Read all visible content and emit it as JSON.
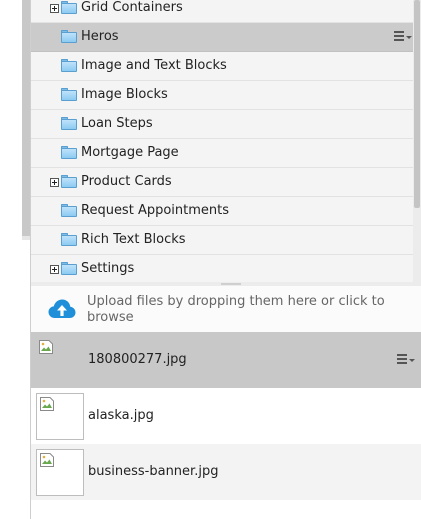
{
  "tree": {
    "items": [
      {
        "label": "Grid Containers",
        "expandable": true,
        "selected": false
      },
      {
        "label": "Heros",
        "expandable": false,
        "selected": true
      },
      {
        "label": "Image and Text Blocks",
        "expandable": false,
        "selected": false
      },
      {
        "label": "Image Blocks",
        "expandable": false,
        "selected": false
      },
      {
        "label": "Loan Steps",
        "expandable": false,
        "selected": false
      },
      {
        "label": "Mortgage Page",
        "expandable": false,
        "selected": false
      },
      {
        "label": "Product Cards",
        "expandable": true,
        "selected": false
      },
      {
        "label": "Request Appointments",
        "expandable": false,
        "selected": false
      },
      {
        "label": "Rich Text Blocks",
        "expandable": false,
        "selected": false
      },
      {
        "label": "Settings",
        "expandable": true,
        "selected": false
      }
    ]
  },
  "upload": {
    "text": "Upload files by dropping them here or click to browse",
    "icon": "cloud-upload-icon",
    "icon_color": "#1e8fd8"
  },
  "files": [
    {
      "name": "180800277.jpg",
      "selected": true
    },
    {
      "name": "alaska.jpg",
      "selected": false
    },
    {
      "name": "business-banner.jpg",
      "selected": false
    }
  ],
  "colors": {
    "selected_row": "#cbcbcb",
    "folder": "#8ccaf2"
  }
}
